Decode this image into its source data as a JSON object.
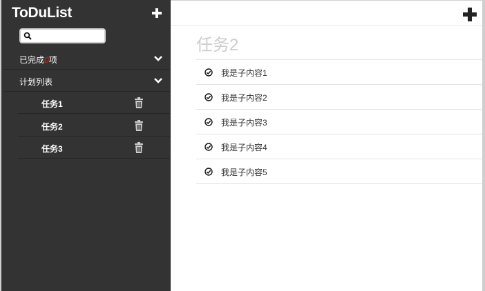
{
  "sidebar": {
    "title": "ToDuList",
    "search": {
      "value": "",
      "placeholder": ""
    },
    "completed": {
      "prefix": "已完成",
      "count": "0",
      "suffix": "项"
    },
    "plans_label": "计划列表",
    "tasks": [
      {
        "label": "任务1"
      },
      {
        "label": "任务2"
      },
      {
        "label": "任务3"
      }
    ]
  },
  "main": {
    "title": "任务2",
    "items": [
      {
        "text": "我是子内容1"
      },
      {
        "text": "我是子内容2"
      },
      {
        "text": "我是子内容3"
      },
      {
        "text": "我是子内容4"
      },
      {
        "text": "我是子内容5"
      }
    ]
  },
  "icons": {
    "add_list": "plus-icon",
    "add_item": "plus-icon",
    "search": "search-icon",
    "expand": "chevron-down-icon",
    "delete": "trash-icon",
    "item_check": "check-circle-icon"
  },
  "colors": {
    "sidebar_bg": "#333333",
    "completed_count": "#d9261c",
    "title_gray": "#cccccc"
  }
}
